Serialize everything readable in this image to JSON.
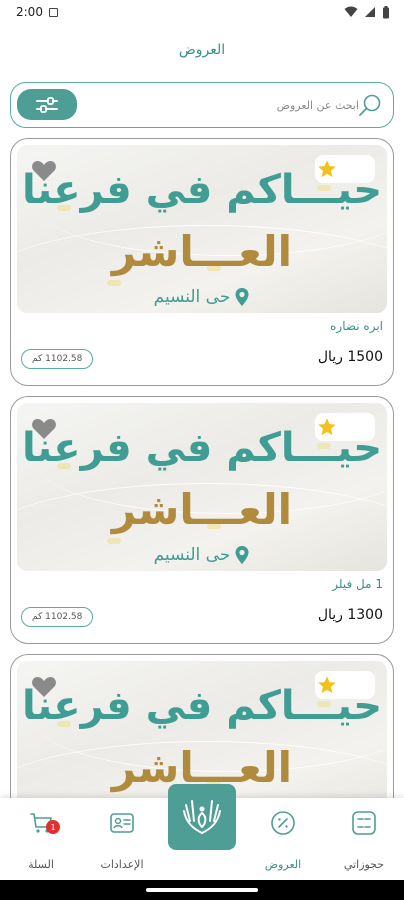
{
  "status_bar": {
    "time": "2:00"
  },
  "header": {
    "title": "العروض"
  },
  "search": {
    "placeholder": "ابحث عن العروض"
  },
  "colors": {
    "accent": "#4f9e96",
    "gold": "#b08a3d",
    "star": "#f2c21b"
  },
  "cards": [
    {
      "promo_line1": "حيـــاكم في فرعنا",
      "promo_line2": "العـــاشر",
      "promo_location": "حى النسيم",
      "name": "ابره نضاره",
      "price": "1500 ريال",
      "distance": "1102.58 كم"
    },
    {
      "promo_line1": "حيـــاكم في فرعنا",
      "promo_line2": "العـــاشر",
      "promo_location": "حى النسيم",
      "name": "1 مل فيلر",
      "price": "1300 ريال",
      "distance": "1102.58 كم"
    },
    {
      "promo_line1": "حيـــاكم في فرعنا",
      "promo_line2": "العـــاشر"
    }
  ],
  "bottom_nav": {
    "bookings": "حجوزاتي",
    "offers": "العروض",
    "settings": "الإعدادات",
    "cart": "السلة",
    "cart_badge": "1"
  }
}
